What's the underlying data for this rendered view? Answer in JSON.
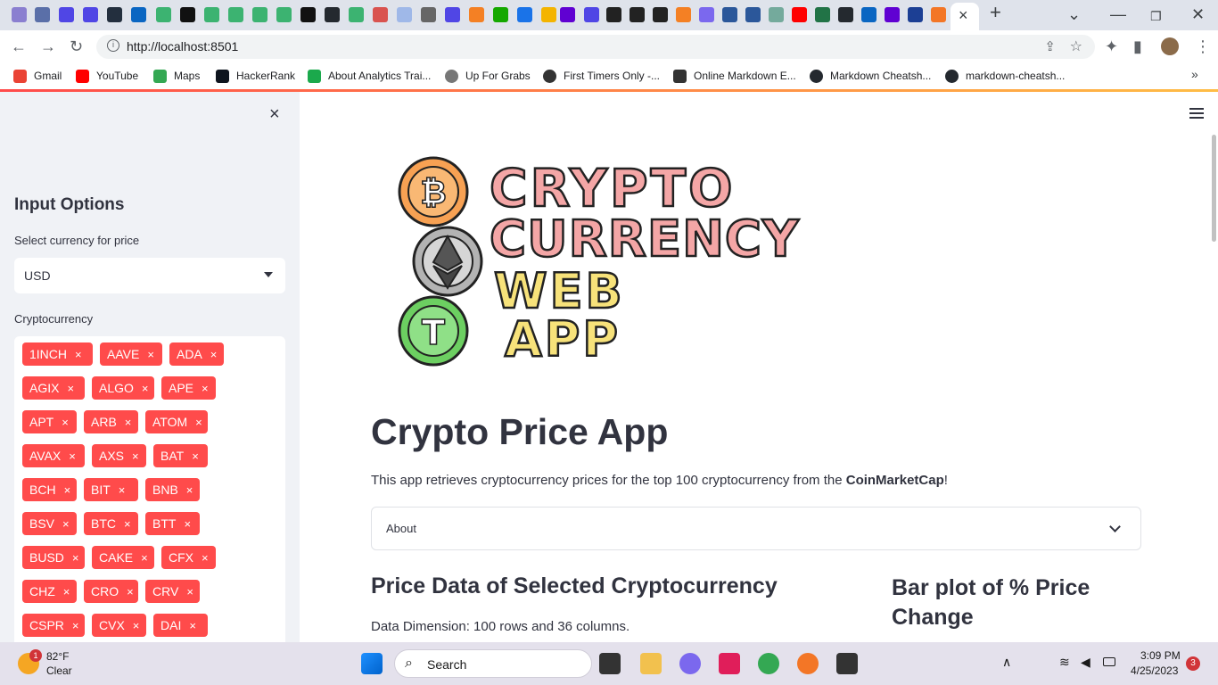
{
  "browser": {
    "url": "http://localhost:8501",
    "new_tab_label": "+",
    "close_tab_label": "×",
    "bookmarks": [
      {
        "label": "Gmail",
        "color": "#ea4335"
      },
      {
        "label": "YouTube",
        "color": "#ff0000"
      },
      {
        "label": "Maps",
        "color": "#34a853"
      },
      {
        "label": "HackerRank",
        "color": "#1ba94c"
      },
      {
        "label": "About Analytics Trai...",
        "color": "#1ba94c"
      },
      {
        "label": "Up For Grabs",
        "color": "#555555"
      },
      {
        "label": "First Timers Only -...",
        "color": "#333333"
      },
      {
        "label": "Online Markdown E...",
        "color": "#333333"
      },
      {
        "label": "Markdown Cheatsh...",
        "color": "#24292f"
      },
      {
        "label": "markdown-cheatsh...",
        "color": "#24292f"
      }
    ]
  },
  "sidebar": {
    "close_label": "×",
    "title": "Input Options",
    "currency_label": "Select currency for price",
    "currency_value": "USD",
    "crypto_label": "Cryptocurrency",
    "chip_remove": "×",
    "chips": [
      [
        "1INCH",
        "AAVE",
        "ADA"
      ],
      [
        "AGIX",
        "ALGO",
        "APE"
      ],
      [
        "APT",
        "ARB",
        "ATOM"
      ],
      [
        "AVAX",
        "AXS",
        "BAT"
      ],
      [
        "BCH",
        "BIT",
        "BNB"
      ],
      [
        "BSV",
        "BTC",
        "BTT"
      ],
      [
        "BUSD",
        "CAKE",
        "CFX"
      ],
      [
        "CHZ",
        "CRO",
        "CRV"
      ],
      [
        "CSPR",
        "CVX",
        "DAI"
      ]
    ]
  },
  "main": {
    "logo": {
      "line1": "CRYPTO",
      "line2": "CURRENCY",
      "line3": "WEB",
      "line4": "APP",
      "btc_symbol": "₿",
      "usdt_symbol": "T"
    },
    "title": "Crypto Price App",
    "intro_text": "This app retrieves cryptocurrency prices for the top 100 cryptocurrency from the ",
    "intro_bold": "CoinMarketCap",
    "intro_end": "!",
    "about_label": "About",
    "price_heading": "Price Data of Selected Cryptocurrency",
    "data_dimension": "Data Dimension: 100 rows and 36 columns.",
    "bar_heading": "Bar plot of % Price Change"
  },
  "taskbar": {
    "weather_temp": "82°F",
    "weather_desc": "Clear",
    "weather_badge": "1",
    "search_label": "Search",
    "time": "3:09 PM",
    "date": "4/25/2023",
    "notif_count": "3"
  },
  "colors": {
    "accent": "#ff4b4b",
    "sidebar_bg": "#f0f2f6",
    "text": "#31333f"
  }
}
